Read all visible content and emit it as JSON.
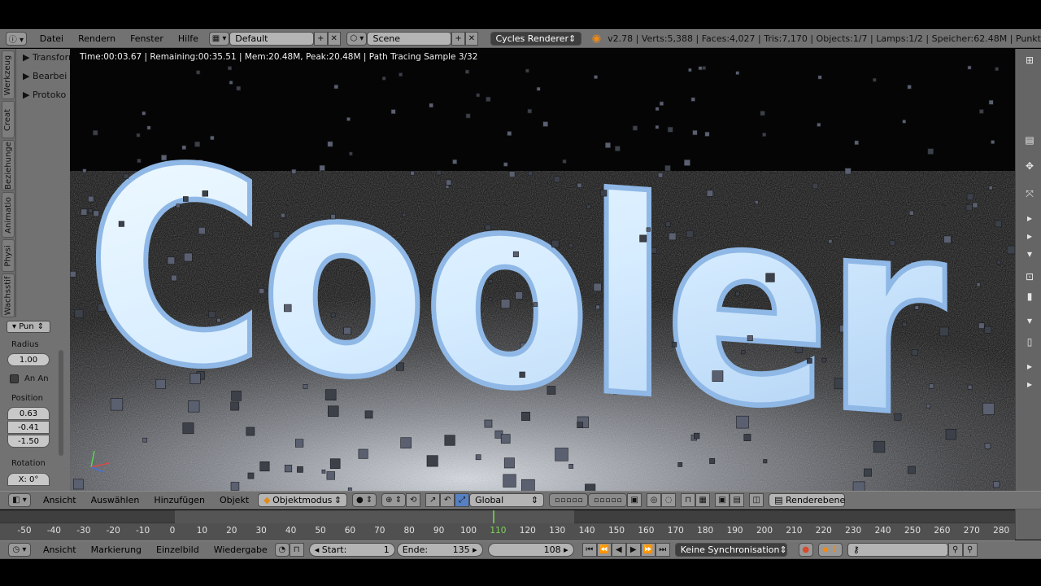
{
  "colors": {
    "panel": "#727272",
    "viewport_bg": "#050505",
    "text_glow": "#dff2ff",
    "playhead": "#6cc04a",
    "record": "#d9492b",
    "keyframe": "#f08a16"
  },
  "topbar": {
    "menus": [
      "Datei",
      "Rendern",
      "Fenster",
      "Hilfe"
    ],
    "screen_layout": "Default",
    "scene": "Scene",
    "render_engine": "Cycles Renderer",
    "stats": "v2.78 | Verts:5,388 | Faces:4,027 | Tris:7,170 | Objects:1/7 | Lamps:1/2 | Speicher:62.48M | Punkt"
  },
  "left_tabs": [
    "Werkzeug",
    "Creat",
    "Beziehunge",
    "Animatio",
    "Physi",
    "Wachsstif"
  ],
  "tool_shelf": {
    "panels": [
      "Transform",
      "Bearbei",
      "Protoko"
    ]
  },
  "redo_panel": {
    "type_label": "Pun",
    "radius_label": "Radius",
    "radius_value": "1.00",
    "align_label": "An An",
    "position_label": "Position",
    "position_values": [
      "0.63",
      "-0.41",
      "-1.50"
    ],
    "rotation_label": "Rotation",
    "rotation_value": "X: 0°"
  },
  "viewport": {
    "render_status": "Time:00:03.67 | Remaining:00:35.51 | Mem:20.48M, Peak:20.48M | Path Tracing Sample 3/32",
    "scene_text": "Cooler"
  },
  "viewport_header": {
    "menus": [
      "Ansicht",
      "Auswählen",
      "Hinzufügen",
      "Objekt"
    ],
    "mode": "Objektmodus",
    "orientation": "Global",
    "render_layer": "Renderebene"
  },
  "timeline": {
    "ticks": [
      "-50",
      "-40",
      "-30",
      "-20",
      "-10",
      "0",
      "10",
      "20",
      "30",
      "40",
      "50",
      "60",
      "70",
      "80",
      "90",
      "100",
      "110",
      "120",
      "130",
      "140",
      "150",
      "160",
      "170",
      "180",
      "190",
      "200",
      "210",
      "220",
      "230",
      "240",
      "250",
      "260",
      "270",
      "280"
    ],
    "current_tick": "110"
  },
  "timeline_header": {
    "menus": [
      "Ansicht",
      "Markierung",
      "Einzelbild",
      "Wiedergabe"
    ],
    "start_label": "Start:",
    "start_value": "1",
    "end_label": "Ende:",
    "end_value": "135",
    "current_frame": "108",
    "sync": "Keine Synchronisation"
  }
}
